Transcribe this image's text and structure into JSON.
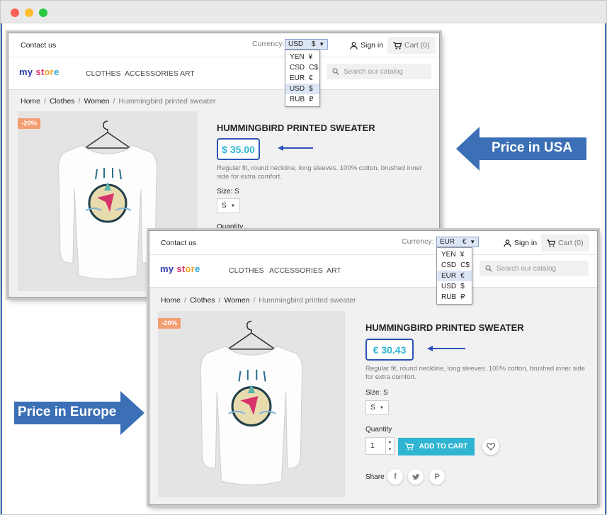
{
  "colors": {
    "accent": "#2fb5d2",
    "callout_blue": "#3b6fb6",
    "price_border": "#2d53b8",
    "discount_badge": "#f39d72"
  },
  "shop_top": {
    "contact": "Contact us",
    "currency_label": "Currency:",
    "currency_value": "USD",
    "currency_symbol": "$",
    "currency_options": [
      {
        "code": "YEN",
        "symbol": "¥"
      },
      {
        "code": "CSD",
        "symbol": "C$"
      },
      {
        "code": "EUR",
        "symbol": "€"
      },
      {
        "code": "USD",
        "symbol": "$"
      },
      {
        "code": "RUB",
        "symbol": "₽"
      }
    ],
    "signin": "Sign in",
    "cart": "Cart (0)",
    "logo": {
      "a": "my",
      "b": "st",
      "c": "or",
      "d": "e"
    },
    "menu": [
      "CLOTHES",
      "ACCESSORIES",
      "ART"
    ],
    "search_placeholder": "Search our catalog",
    "breadcrumb": [
      "Home",
      "Clothes",
      "Women",
      "Hummingbird printed sweater"
    ],
    "badge": "-20%",
    "product_title": "HUMMINGBIRD PRINTED SWEATER",
    "price": "$ 35.00",
    "description": "Regular fit, round neckline, long sleeves. 100% cotton, brushed inner side for extra comfort.",
    "size_label": "Size: S",
    "size_value": "S",
    "quantity_label": "Quantity"
  },
  "shop_bottom": {
    "contact": "Contact us",
    "currency_label": "Currency:",
    "currency_value": "EUR",
    "currency_symbol": "€",
    "currency_options": [
      {
        "code": "YEN",
        "symbol": "¥"
      },
      {
        "code": "CSD",
        "symbol": "C$"
      },
      {
        "code": "EUR",
        "symbol": "€"
      },
      {
        "code": "USD",
        "symbol": "$"
      },
      {
        "code": "RUB",
        "symbol": "₽"
      }
    ],
    "signin": "Sign in",
    "cart": "Cart (0)",
    "logo": {
      "a": "my",
      "b": "st",
      "c": "or",
      "d": "e"
    },
    "menu": [
      "CLOTHES",
      "ACCESSORIES",
      "ART"
    ],
    "search_placeholder": "Search our catalog",
    "breadcrumb": [
      "Home",
      "Clothes",
      "Women",
      "Hummingbird printed sweater"
    ],
    "badge": "-20%",
    "product_title": "HUMMINGBIRD PRINTED SWEATER",
    "price": "€ 30.43",
    "description": "Regular fit, round neckline, long sleeves. 100% cotton, brushed inner side for extra comfort.",
    "size_label": "Size: S",
    "size_value": "S",
    "quantity_label": "Quantity",
    "quantity_value": "1",
    "add_to_cart": "ADD TO CART",
    "share_label": "Share",
    "share_icons": [
      "facebook-icon",
      "twitter-icon",
      "pinterest-icon"
    ]
  },
  "callouts": {
    "usa": "Price in USA",
    "europe": "Price in Europe"
  }
}
